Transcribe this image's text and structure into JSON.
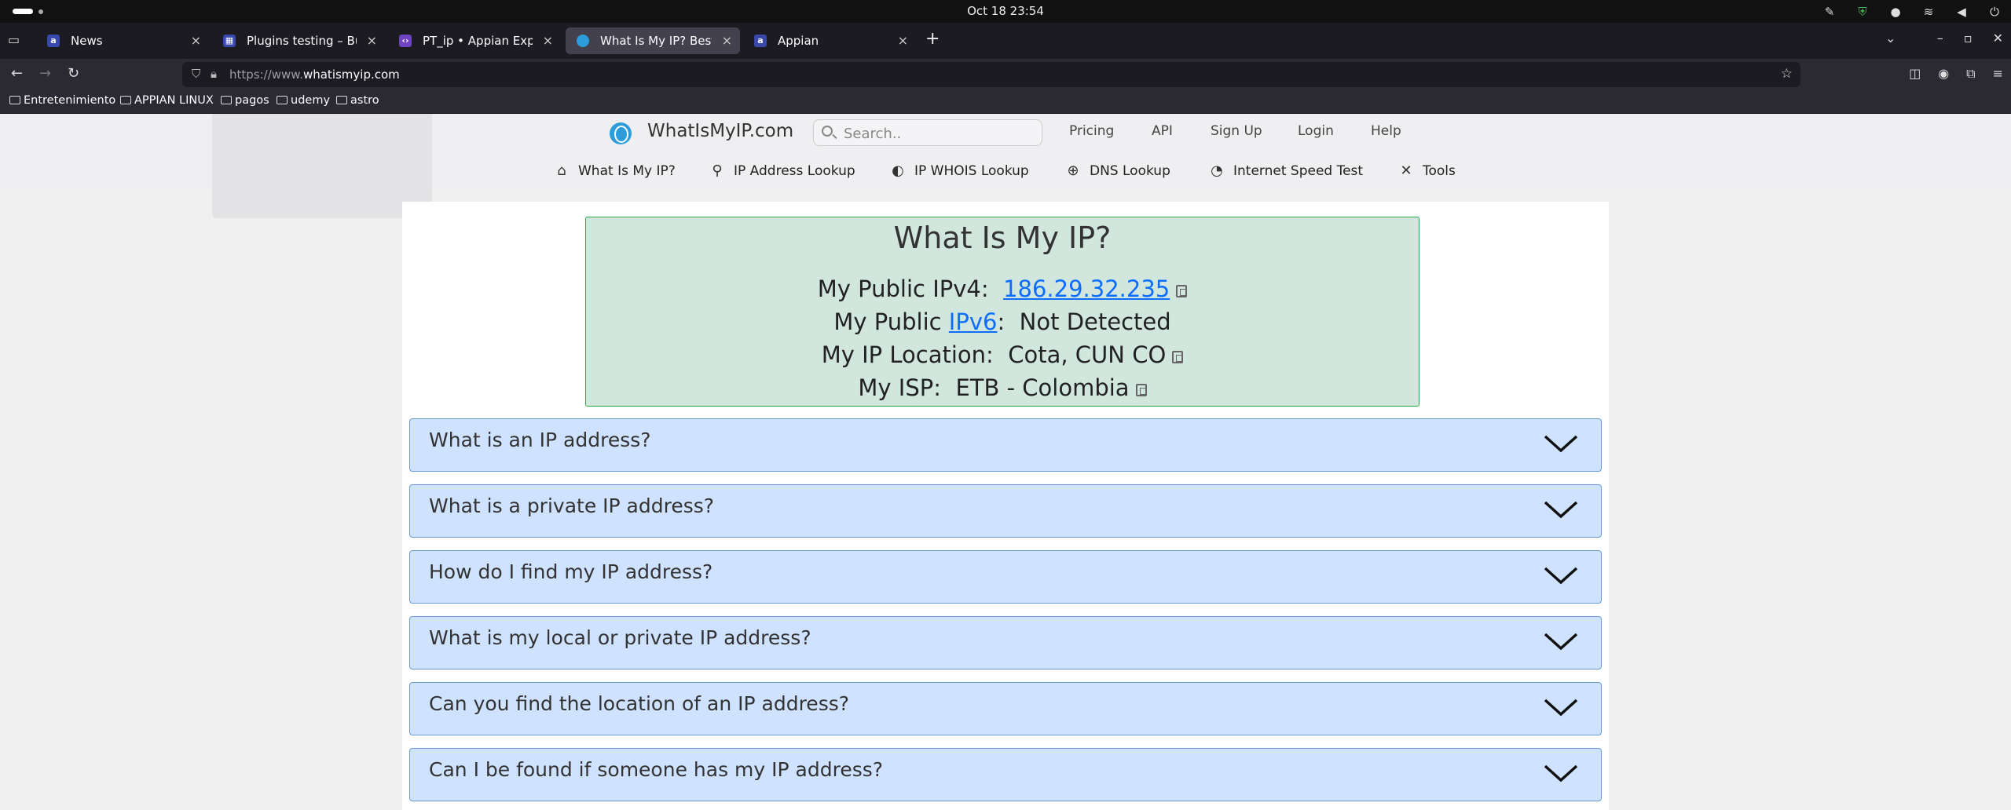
{
  "os": {
    "datetime": "Oct 18  23:54"
  },
  "browser": {
    "tabs": [
      {
        "label": "News",
        "favicon": "appian-a",
        "color": "#3949ab",
        "active": false
      },
      {
        "label": "Plugins testing – Build –",
        "favicon": "grid-icon",
        "color": "#3949ab",
        "active": false
      },
      {
        "label": "PT_ip • Appian Expression",
        "favicon": "code-icon",
        "color": "#6f42c1",
        "active": false
      },
      {
        "label": "What Is My IP? Best Way To",
        "favicon": "globe-icon",
        "color": "#2d9cdb",
        "active": true
      },
      {
        "label": "Appian",
        "favicon": "appian-a",
        "color": "#3949ab",
        "active": false
      }
    ],
    "url_prefix": "https://www.",
    "url_domain": "whatismyip.com",
    "bookmarks": [
      "Entretenimiento",
      "APPIAN LINUX",
      "pagos",
      "udemy",
      "astro"
    ]
  },
  "site": {
    "logo": "WhatIsMyIP.com",
    "search_placeholder": "Search..",
    "top_links": [
      "Pricing",
      "API",
      "Sign Up",
      "Login",
      "Help"
    ],
    "nav": [
      {
        "label": "What Is My IP?",
        "icon": "home-icon"
      },
      {
        "label": "IP Address Lookup",
        "icon": "map-pin-icon"
      },
      {
        "label": "IP WHOIS Lookup",
        "icon": "globe-icon"
      },
      {
        "label": "DNS Lookup",
        "icon": "network-globe-icon"
      },
      {
        "label": "Internet Speed Test",
        "icon": "speedometer-icon"
      },
      {
        "label": "Tools",
        "icon": "tools-icon"
      }
    ]
  },
  "ipbox": {
    "title": "What Is My IP?",
    "ipv4_label": "My Public IPv4:",
    "ipv4_value": "186.29.32.235",
    "ipv6_label_pre": "My Public ",
    "ipv6_link": "IPv6",
    "ipv6_label_post": ":",
    "ipv6_value": "Not Detected",
    "location_label": "My IP Location:",
    "location_value": "Cota, CUN CO",
    "isp_label": "My ISP:",
    "isp_value": "ETB - Colombia"
  },
  "faqs": [
    "What is an IP address?",
    "What is a private IP address?",
    "How do I find my IP address?",
    "What is my local or private IP address?",
    "Can you find the location of an IP address?",
    "Can I be found if someone has my IP address?"
  ]
}
